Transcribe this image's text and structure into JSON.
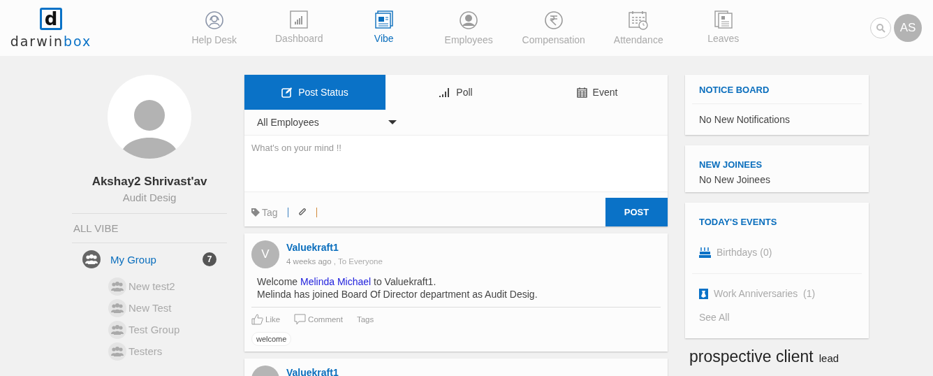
{
  "header": {
    "logo": {
      "mark": "d",
      "name_dark": "darwin",
      "name_accent": "box"
    },
    "nav": [
      {
        "label": "Help Desk",
        "selected": false
      },
      {
        "label": "Dashboard",
        "selected": false
      },
      {
        "label": "Vibe",
        "selected": true
      },
      {
        "label": "Employees",
        "selected": false
      },
      {
        "label": "Compensation",
        "selected": false
      },
      {
        "label": "Attendance",
        "selected": false
      },
      {
        "label": "Leaves",
        "selected": false
      }
    ],
    "avatar": "AS"
  },
  "profile": {
    "name": "Akshay2 Shrivast'av",
    "designation": "Audit Desig"
  },
  "sidebar": {
    "heading": "ALL VIBE",
    "group": {
      "label": "My Group",
      "count": "7"
    },
    "items": [
      {
        "label": "New test2"
      },
      {
        "label": "New Test"
      },
      {
        "label": "Test Group"
      },
      {
        "label": "Testers"
      }
    ]
  },
  "composer": {
    "tabs": [
      {
        "label": "Post Status",
        "selected": true
      },
      {
        "label": "Poll",
        "selected": false
      },
      {
        "label": "Event",
        "selected": false
      }
    ],
    "audience": "All Employees",
    "placeholder": "What's on your mind !!",
    "tag": "Tag",
    "post_button": "POST"
  },
  "posts": [
    {
      "author": "Valuekraft1",
      "avatar": "V",
      "time": "4 weeks ago",
      "audience": ", To Everyone",
      "body": [
        {
          "before": "Welcome ",
          "link": "Melinda Michael",
          "after": " to Valuekraft1."
        },
        {
          "before": "Melinda has joined Board Of Director department as Audit Desig."
        }
      ],
      "actions": [
        "Like",
        "Comment",
        "Tags"
      ],
      "tags": [
        "welcome"
      ]
    },
    {
      "author": "Valuekraft1"
    }
  ],
  "notice_board": {
    "title": "NOTICE BOARD",
    "text": "No New Notifications"
  },
  "new_joinees": {
    "title": "NEW JOINEES",
    "text": "No New Joinees"
  },
  "todays_events": {
    "title": "TODAY'S EVENTS",
    "events": [
      {
        "kind": "birthday",
        "label": "Birthdays (0)"
      },
      {
        "kind": "anniversary",
        "label": "Work Anniversaries  (1)"
      }
    ],
    "link": "See All"
  },
  "tag_cloud": [
    {
      "text": "prospective client",
      "kind": "large"
    },
    {
      "text": "lead",
      "kind": "small"
    }
  ]
}
